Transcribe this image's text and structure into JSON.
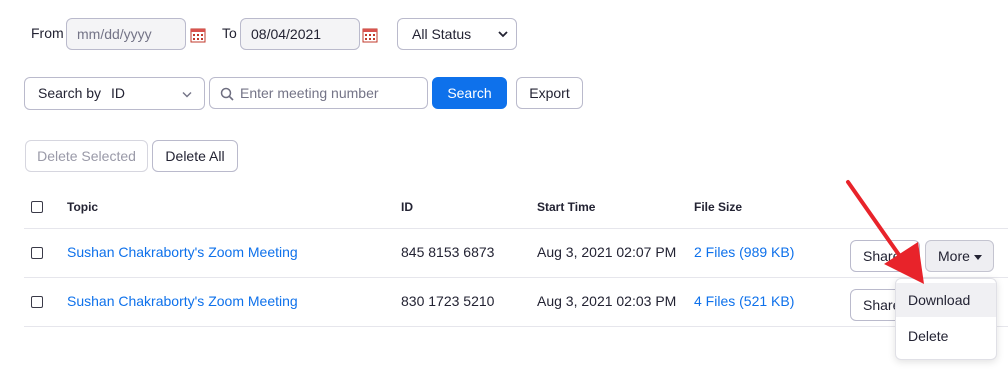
{
  "filters": {
    "from_label": "From",
    "from_placeholder": "mm/dd/yyyy",
    "to_label": "To",
    "to_value": "08/04/2021",
    "status_select": "All Status"
  },
  "search": {
    "search_by_label": "Search by",
    "search_by_value": "ID",
    "input_placeholder": "Enter meeting number",
    "search_button": "Search",
    "export_button": "Export"
  },
  "bulk": {
    "delete_selected": "Delete Selected",
    "delete_all": "Delete All"
  },
  "table": {
    "headers": {
      "topic": "Topic",
      "id": "ID",
      "start_time": "Start Time",
      "file_size": "File Size"
    },
    "rows": [
      {
        "topic": "Sushan Chakraborty's Zoom Meeting",
        "id": "845 8153 6873",
        "start_time": "Aug 3, 2021 02:07 PM",
        "file_size": "2 Files (989 KB)",
        "share": "Share",
        "more": "More"
      },
      {
        "topic": "Sushan Chakraborty's Zoom Meeting",
        "id": "830 1723 5210",
        "start_time": "Aug 3, 2021 02:03 PM",
        "file_size": "4 Files (521 KB)",
        "share": "Share"
      }
    ]
  },
  "dropdown_menu": {
    "items": [
      "Download",
      "Delete"
    ]
  },
  "colors": {
    "primary": "#0e71eb",
    "annotation_arrow": "#e8232a"
  },
  "icons": [
    "calendar-icon",
    "chevron-down-icon",
    "search-icon",
    "caret-down-icon",
    "arrow-annotation"
  ]
}
